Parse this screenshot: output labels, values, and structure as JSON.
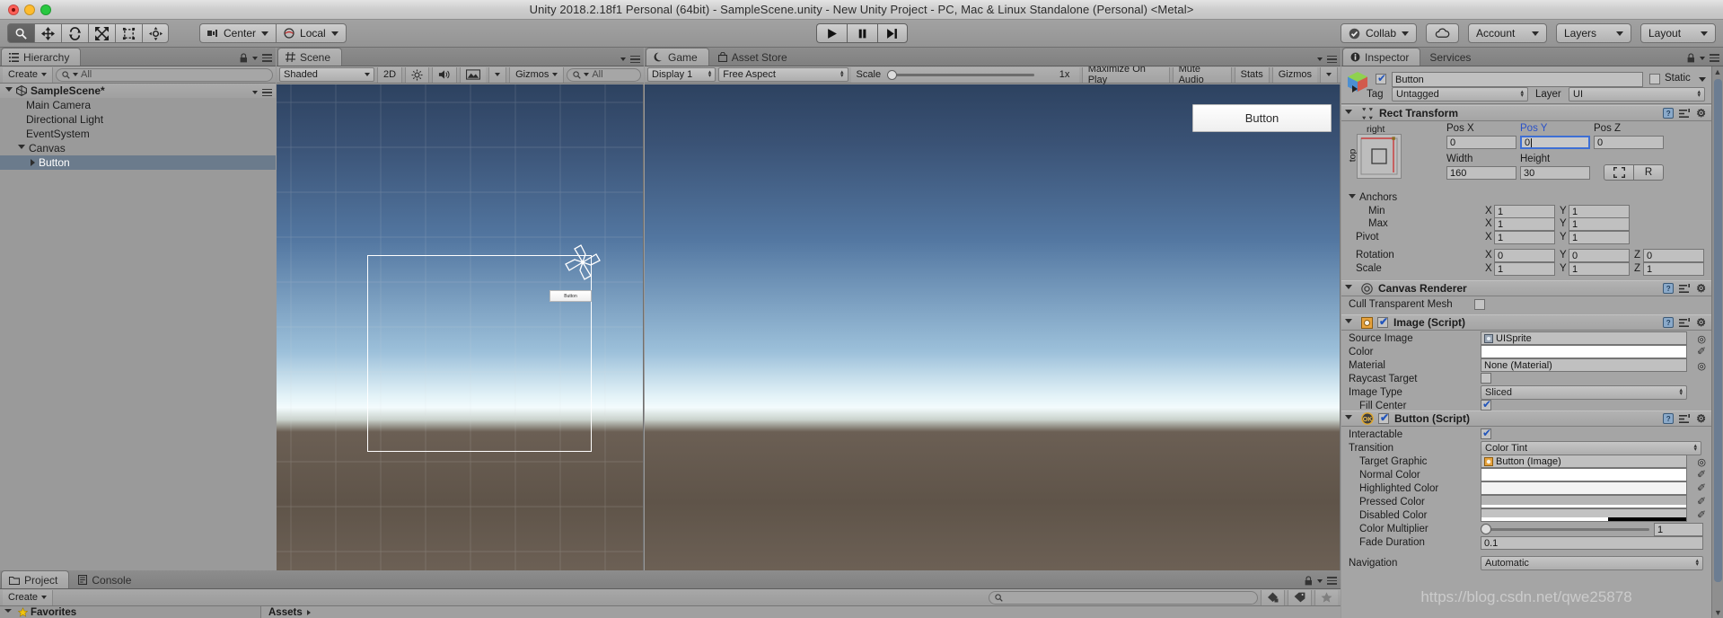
{
  "window": {
    "title": "Unity 2018.2.18f1 Personal (64bit) - SampleScene.unity - New Unity Project - PC, Mac & Linux Standalone (Personal) <Metal>"
  },
  "toolbar": {
    "tools": [
      "hand-tool",
      "move-tool",
      "rotate-tool",
      "scale-tool",
      "rect-tool",
      "transform-tool"
    ],
    "pivot_mode": "Center",
    "pivot_rotation": "Local",
    "play": "play-icon",
    "pause": "pause-icon",
    "step": "step-icon",
    "collab": "Collab",
    "cloud": "cloud-icon",
    "account": "Account",
    "layers": "Layers",
    "layout": "Layout"
  },
  "hierarchy": {
    "tab": "Hierarchy",
    "create_label": "Create",
    "search_placeholder": "All",
    "scene_name": "SampleScene*",
    "items": [
      {
        "label": "Main Camera",
        "depth": 1,
        "expandable": false,
        "selected": false
      },
      {
        "label": "Directional Light",
        "depth": 1,
        "expandable": false,
        "selected": false
      },
      {
        "label": "EventSystem",
        "depth": 1,
        "expandable": false,
        "selected": false
      },
      {
        "label": "Canvas",
        "depth": 1,
        "expandable": true,
        "expanded": true,
        "selected": false
      },
      {
        "label": "Button",
        "depth": 2,
        "expandable": true,
        "expanded": false,
        "selected": true
      }
    ]
  },
  "scene_view": {
    "tab": "Scene",
    "draw_mode": "Shaded",
    "mode_2d": "2D",
    "lighting": "lighting-icon",
    "audio": "audio-icon",
    "effects": "effects-icon",
    "gizmos": "Gizmos",
    "search_placeholder": "All",
    "selection_label": "Button"
  },
  "game_view": {
    "tab": "Game",
    "asset_store_tab": "Asset Store",
    "display": "Display 1",
    "aspect": "Free Aspect",
    "scale_label": "Scale",
    "scale_value": "1x",
    "maximize_on_play": "Maximize On Play",
    "mute_audio": "Mute Audio",
    "stats": "Stats",
    "gizmos": "Gizmos",
    "button_label": "Button"
  },
  "inspector": {
    "tab": "Inspector",
    "services_tab": "Services",
    "enabled": true,
    "object_name": "Button",
    "static_label": "Static",
    "static_checked": false,
    "tag_label": "Tag",
    "tag_value": "Untagged",
    "layer_label": "Layer",
    "layer_value": "UI",
    "rect_transform": {
      "title": "Rect Transform",
      "anchor_preset_h": "right",
      "anchor_preset_v": "top",
      "pos_x_label": "Pos X",
      "pos_x": "0",
      "pos_y_label": "Pos Y",
      "pos_y": "0",
      "pos_z_label": "Pos Z",
      "pos_z": "0",
      "width_label": "Width",
      "width": "160",
      "height_label": "Height",
      "height": "30",
      "blueprint_btn": "blueprint-icon",
      "raw_btn": "R",
      "anchors_label": "Anchors",
      "min_label": "Min",
      "min_x": "1",
      "min_y": "1",
      "max_label": "Max",
      "max_x": "1",
      "max_y": "1",
      "pivot_label": "Pivot",
      "pivot_x": "1",
      "pivot_y": "1",
      "rotation_label": "Rotation",
      "rot_x": "0",
      "rot_y": "0",
      "rot_z": "0",
      "scale_label": "Scale",
      "scl_x": "1",
      "scl_y": "1",
      "scl_z": "1",
      "axis_x": "X",
      "axis_y": "Y",
      "axis_z": "Z"
    },
    "canvas_renderer": {
      "title": "Canvas Renderer",
      "cull_label": "Cull Transparent Mesh",
      "cull_checked": false
    },
    "image_script": {
      "title": "Image (Script)",
      "enabled": true,
      "source_image_label": "Source Image",
      "source_image_value": "UISprite",
      "color_label": "Color",
      "color_value": "#FFFFFF",
      "material_label": "Material",
      "material_value": "None (Material)",
      "raycast_label": "Raycast Target",
      "raycast_checked": false,
      "image_type_label": "Image Type",
      "image_type_value": "Sliced",
      "fill_center_label": "Fill Center",
      "fill_center_checked": true
    },
    "button_script": {
      "title": "Button (Script)",
      "enabled": true,
      "interactable_label": "Interactable",
      "interactable_checked": true,
      "transition_label": "Transition",
      "transition_value": "Color Tint",
      "target_graphic_label": "Target Graphic",
      "target_graphic_value": "Button (Image)",
      "normal_color_label": "Normal Color",
      "normal_color": "#FFFFFF",
      "highlighted_color_label": "Highlighted Color",
      "highlighted_color": "#F5F5F5",
      "pressed_color_label": "Pressed Color",
      "pressed_color": "#C8C8C8",
      "disabled_color_label": "Disabled Color",
      "disabled_color": "#C8C8C8",
      "color_multiplier_label": "Color Multiplier",
      "color_multiplier": "1",
      "fade_duration_label": "Fade Duration",
      "fade_duration": "0.1",
      "navigation_label": "Navigation",
      "navigation_value": "Automatic"
    }
  },
  "project": {
    "tab": "Project",
    "console_tab": "Console",
    "create_label": "Create",
    "search_placeholder": "",
    "favorites_label": "Favorites",
    "assets_label": "Assets"
  },
  "watermark": "https://blog.csdn.net/qwe25878"
}
